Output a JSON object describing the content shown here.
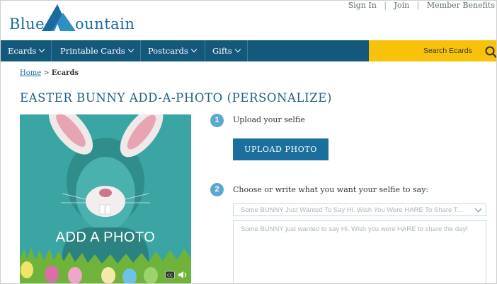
{
  "brand": {
    "logo_text_left": "Blue",
    "logo_text_right": "ountain"
  },
  "top_nav": {
    "sign_in": "Sign In",
    "join": "Join",
    "member_benefits": "Member Benefits",
    "separator": "|"
  },
  "main_nav": {
    "items": [
      {
        "label": "Ecards"
      },
      {
        "label": "Printable Cards"
      },
      {
        "label": "Postcards"
      },
      {
        "label": "Gifts"
      }
    ]
  },
  "search": {
    "label": "Search Ecards",
    "icon": "search-icon"
  },
  "breadcrumb": {
    "home": "Home",
    "sep": ">",
    "current": "Ecards"
  },
  "page": {
    "title": "EASTER BUNNY ADD-A-PHOTO (PERSONALIZE)"
  },
  "preview": {
    "overlay_text": "ADD A PHOTO",
    "controls": [
      "closed-caption-icon",
      "speaker-icon"
    ]
  },
  "steps": [
    {
      "number": "1",
      "label": "Upload your selfie",
      "button": "UPLOAD PHOTO"
    },
    {
      "number": "2",
      "label": "Choose or write what you want your selfie to say:"
    }
  ],
  "message": {
    "select_value": "Some BUNNY Just Wanted To Say Hi. Wish You Were HARE To Share T...",
    "textarea_placeholder": "Some BUNNY just wanted to say Hi. Wish you were HARE to share the day!"
  },
  "colors": {
    "nav_bg": "#14597c",
    "search_bg": "#f7c209",
    "accent": "#1b6f9c",
    "step_circle": "#5aa8cf",
    "photo_bg": "#3aa5a3"
  }
}
